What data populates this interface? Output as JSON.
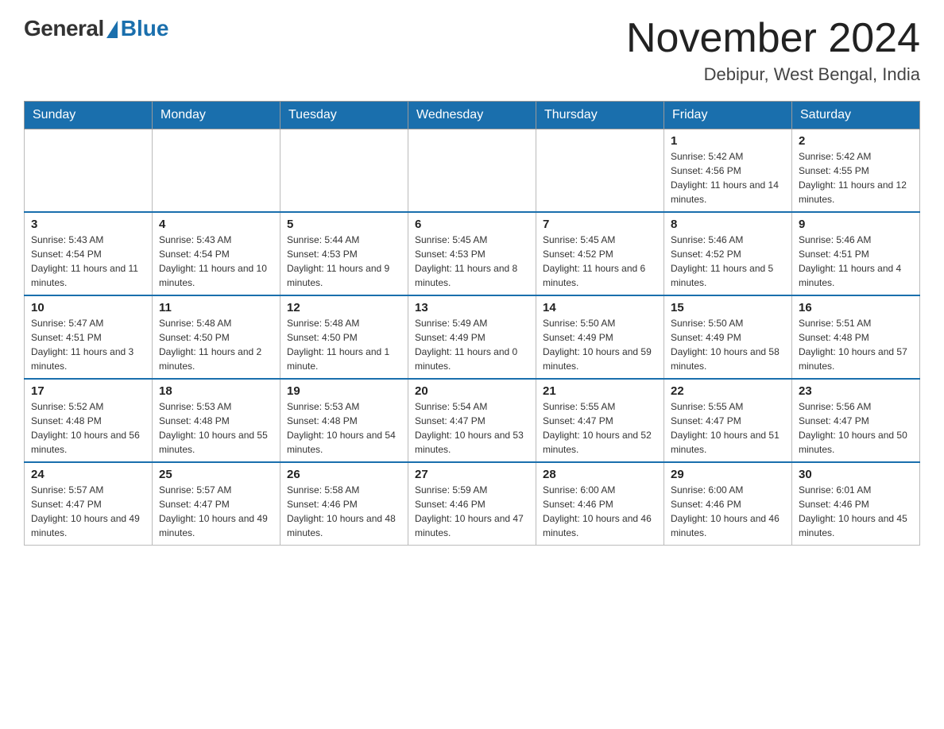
{
  "logo": {
    "general": "General",
    "blue": "Blue"
  },
  "header": {
    "month": "November 2024",
    "location": "Debipur, West Bengal, India"
  },
  "weekdays": [
    "Sunday",
    "Monday",
    "Tuesday",
    "Wednesday",
    "Thursday",
    "Friday",
    "Saturday"
  ],
  "weeks": [
    [
      {
        "day": "",
        "sunrise": "",
        "sunset": "",
        "daylight": ""
      },
      {
        "day": "",
        "sunrise": "",
        "sunset": "",
        "daylight": ""
      },
      {
        "day": "",
        "sunrise": "",
        "sunset": "",
        "daylight": ""
      },
      {
        "day": "",
        "sunrise": "",
        "sunset": "",
        "daylight": ""
      },
      {
        "day": "",
        "sunrise": "",
        "sunset": "",
        "daylight": ""
      },
      {
        "day": "1",
        "sunrise": "Sunrise: 5:42 AM",
        "sunset": "Sunset: 4:56 PM",
        "daylight": "Daylight: 11 hours and 14 minutes."
      },
      {
        "day": "2",
        "sunrise": "Sunrise: 5:42 AM",
        "sunset": "Sunset: 4:55 PM",
        "daylight": "Daylight: 11 hours and 12 minutes."
      }
    ],
    [
      {
        "day": "3",
        "sunrise": "Sunrise: 5:43 AM",
        "sunset": "Sunset: 4:54 PM",
        "daylight": "Daylight: 11 hours and 11 minutes."
      },
      {
        "day": "4",
        "sunrise": "Sunrise: 5:43 AM",
        "sunset": "Sunset: 4:54 PM",
        "daylight": "Daylight: 11 hours and 10 minutes."
      },
      {
        "day": "5",
        "sunrise": "Sunrise: 5:44 AM",
        "sunset": "Sunset: 4:53 PM",
        "daylight": "Daylight: 11 hours and 9 minutes."
      },
      {
        "day": "6",
        "sunrise": "Sunrise: 5:45 AM",
        "sunset": "Sunset: 4:53 PM",
        "daylight": "Daylight: 11 hours and 8 minutes."
      },
      {
        "day": "7",
        "sunrise": "Sunrise: 5:45 AM",
        "sunset": "Sunset: 4:52 PM",
        "daylight": "Daylight: 11 hours and 6 minutes."
      },
      {
        "day": "8",
        "sunrise": "Sunrise: 5:46 AM",
        "sunset": "Sunset: 4:52 PM",
        "daylight": "Daylight: 11 hours and 5 minutes."
      },
      {
        "day": "9",
        "sunrise": "Sunrise: 5:46 AM",
        "sunset": "Sunset: 4:51 PM",
        "daylight": "Daylight: 11 hours and 4 minutes."
      }
    ],
    [
      {
        "day": "10",
        "sunrise": "Sunrise: 5:47 AM",
        "sunset": "Sunset: 4:51 PM",
        "daylight": "Daylight: 11 hours and 3 minutes."
      },
      {
        "day": "11",
        "sunrise": "Sunrise: 5:48 AM",
        "sunset": "Sunset: 4:50 PM",
        "daylight": "Daylight: 11 hours and 2 minutes."
      },
      {
        "day": "12",
        "sunrise": "Sunrise: 5:48 AM",
        "sunset": "Sunset: 4:50 PM",
        "daylight": "Daylight: 11 hours and 1 minute."
      },
      {
        "day": "13",
        "sunrise": "Sunrise: 5:49 AM",
        "sunset": "Sunset: 4:49 PM",
        "daylight": "Daylight: 11 hours and 0 minutes."
      },
      {
        "day": "14",
        "sunrise": "Sunrise: 5:50 AM",
        "sunset": "Sunset: 4:49 PM",
        "daylight": "Daylight: 10 hours and 59 minutes."
      },
      {
        "day": "15",
        "sunrise": "Sunrise: 5:50 AM",
        "sunset": "Sunset: 4:49 PM",
        "daylight": "Daylight: 10 hours and 58 minutes."
      },
      {
        "day": "16",
        "sunrise": "Sunrise: 5:51 AM",
        "sunset": "Sunset: 4:48 PM",
        "daylight": "Daylight: 10 hours and 57 minutes."
      }
    ],
    [
      {
        "day": "17",
        "sunrise": "Sunrise: 5:52 AM",
        "sunset": "Sunset: 4:48 PM",
        "daylight": "Daylight: 10 hours and 56 minutes."
      },
      {
        "day": "18",
        "sunrise": "Sunrise: 5:53 AM",
        "sunset": "Sunset: 4:48 PM",
        "daylight": "Daylight: 10 hours and 55 minutes."
      },
      {
        "day": "19",
        "sunrise": "Sunrise: 5:53 AM",
        "sunset": "Sunset: 4:48 PM",
        "daylight": "Daylight: 10 hours and 54 minutes."
      },
      {
        "day": "20",
        "sunrise": "Sunrise: 5:54 AM",
        "sunset": "Sunset: 4:47 PM",
        "daylight": "Daylight: 10 hours and 53 minutes."
      },
      {
        "day": "21",
        "sunrise": "Sunrise: 5:55 AM",
        "sunset": "Sunset: 4:47 PM",
        "daylight": "Daylight: 10 hours and 52 minutes."
      },
      {
        "day": "22",
        "sunrise": "Sunrise: 5:55 AM",
        "sunset": "Sunset: 4:47 PM",
        "daylight": "Daylight: 10 hours and 51 minutes."
      },
      {
        "day": "23",
        "sunrise": "Sunrise: 5:56 AM",
        "sunset": "Sunset: 4:47 PM",
        "daylight": "Daylight: 10 hours and 50 minutes."
      }
    ],
    [
      {
        "day": "24",
        "sunrise": "Sunrise: 5:57 AM",
        "sunset": "Sunset: 4:47 PM",
        "daylight": "Daylight: 10 hours and 49 minutes."
      },
      {
        "day": "25",
        "sunrise": "Sunrise: 5:57 AM",
        "sunset": "Sunset: 4:47 PM",
        "daylight": "Daylight: 10 hours and 49 minutes."
      },
      {
        "day": "26",
        "sunrise": "Sunrise: 5:58 AM",
        "sunset": "Sunset: 4:46 PM",
        "daylight": "Daylight: 10 hours and 48 minutes."
      },
      {
        "day": "27",
        "sunrise": "Sunrise: 5:59 AM",
        "sunset": "Sunset: 4:46 PM",
        "daylight": "Daylight: 10 hours and 47 minutes."
      },
      {
        "day": "28",
        "sunrise": "Sunrise: 6:00 AM",
        "sunset": "Sunset: 4:46 PM",
        "daylight": "Daylight: 10 hours and 46 minutes."
      },
      {
        "day": "29",
        "sunrise": "Sunrise: 6:00 AM",
        "sunset": "Sunset: 4:46 PM",
        "daylight": "Daylight: 10 hours and 46 minutes."
      },
      {
        "day": "30",
        "sunrise": "Sunrise: 6:01 AM",
        "sunset": "Sunset: 4:46 PM",
        "daylight": "Daylight: 10 hours and 45 minutes."
      }
    ]
  ]
}
